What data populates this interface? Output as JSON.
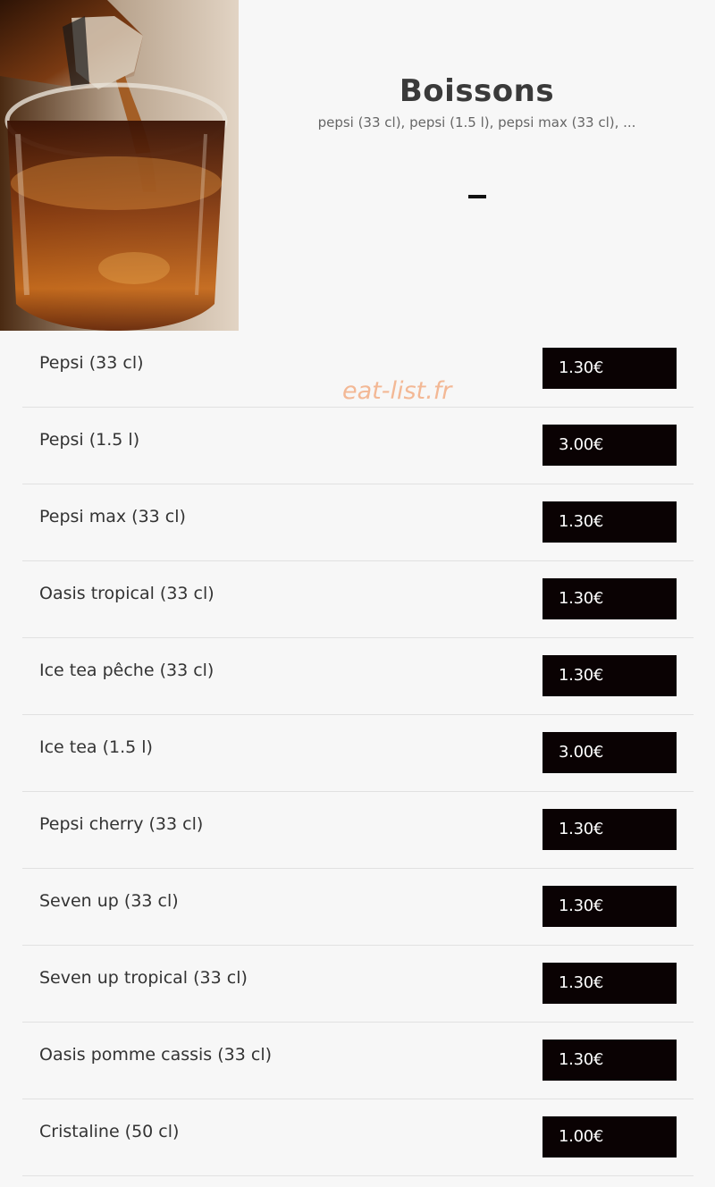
{
  "header": {
    "title": "Boissons",
    "subtitle": "pepsi (33 cl), pepsi (1.5 l), pepsi max (33 cl), ...",
    "dash": "-"
  },
  "watermark": "eat-list.fr",
  "menu": {
    "items": [
      {
        "name": "Pepsi (33 cl)",
        "price": "1.30€"
      },
      {
        "name": "Pepsi (1.5 l)",
        "price": "3.00€"
      },
      {
        "name": "Pepsi max (33 cl)",
        "price": "1.30€"
      },
      {
        "name": "Oasis tropical (33 cl)",
        "price": "1.30€"
      },
      {
        "name": "Ice tea pêche (33 cl)",
        "price": "1.30€"
      },
      {
        "name": "Ice tea (1.5 l)",
        "price": "3.00€"
      },
      {
        "name": "Pepsi cherry (33 cl)",
        "price": "1.30€"
      },
      {
        "name": "Seven up (33 cl)",
        "price": "1.30€"
      },
      {
        "name": "Seven up tropical (33 cl)",
        "price": "1.30€"
      },
      {
        "name": "Oasis pomme cassis (33 cl)",
        "price": "1.30€"
      },
      {
        "name": "Cristaline (50 cl)",
        "price": "1.00€"
      }
    ]
  },
  "colors": {
    "background": "#f7f7f7",
    "price_badge": "#0a0203",
    "watermark": "#f3b895"
  }
}
